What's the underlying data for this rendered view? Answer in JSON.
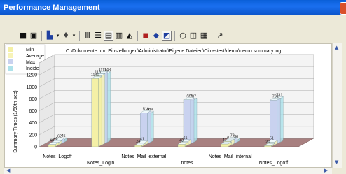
{
  "window": {
    "title": "Performance Management"
  },
  "toolbar": {
    "icons": [
      "save-icon",
      "copy-icon",
      "chart-type-icon",
      "palette-icon",
      "vertical-grid-icon",
      "horizontal-grid-icon",
      "legend-icon",
      "data-table-icon",
      "3d-icon",
      "view-3d-icon",
      "rotate-icon",
      "options-icon",
      "zoom-icon",
      "print-preview-icon",
      "print-icon",
      "pointer-icon"
    ]
  },
  "chart": {
    "path_label": "C:\\Dokumente und Einstellungen\\Administrator\\Eigene Dateien\\Citrastest\\demo\\demo.summary.log"
  },
  "chart_data": {
    "type": "bar",
    "title": "",
    "xlabel": "",
    "ylabel": "Summary Times (1/50th sec)",
    "ylim": [
      0,
      1400
    ],
    "yticks": [
      "0",
      "200",
      "400",
      "600",
      "800",
      "1000",
      "1200"
    ],
    "grid": true,
    "legend_position": "top-left",
    "colors": {
      "Min": "#f4f0a6",
      "Average": "#f7f3b8",
      "Max": "#c9d2ef",
      "Incidences": "#aee2ea"
    },
    "categories": [
      "Notes_Logoff",
      "Notes_Login",
      "Notes_Mail_external",
      "notes",
      "Notes_Mail_internal",
      "Notes_Logoff"
    ],
    "series": [
      {
        "name": "Min",
        "values": [
          40,
          1140,
          24,
          43,
          47,
          20
        ]
      },
      {
        "name": "Average",
        "values": [
          45,
          1161,
          41,
          61,
          70,
          51
        ]
      },
      {
        "name": "Max",
        "values": [
          62,
          1174,
          519,
          738,
          73,
          731
        ]
      },
      {
        "name": "Incidences",
        "values": [
          45,
          1148,
          489,
          707,
          36,
          731
        ]
      }
    ]
  }
}
